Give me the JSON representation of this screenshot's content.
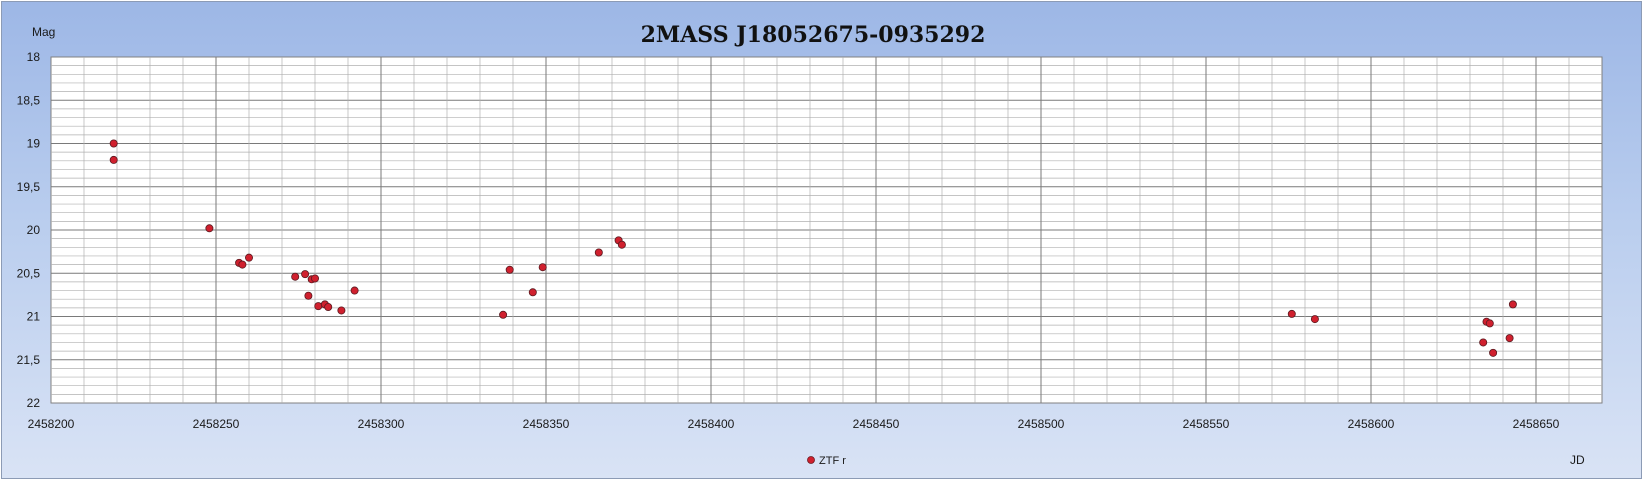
{
  "chart_data": {
    "type": "scatter",
    "title": "2MASS J18052675-0935292",
    "ylabel": "Mag",
    "xlabel": "JD",
    "x_ticks": [
      2458200,
      2458250,
      2458300,
      2458350,
      2458400,
      2458450,
      2458500,
      2458550,
      2458600,
      2458650
    ],
    "y_ticks": [
      "18",
      "18,5",
      "19",
      "19,5",
      "20",
      "20,5",
      "21",
      "21,5",
      "22"
    ],
    "xlim": [
      2458200,
      2458670
    ],
    "ylim": [
      18,
      22
    ],
    "y_inverted": true,
    "grid": true,
    "legend_position": "bottom-center",
    "series": [
      {
        "name": "ZTF r",
        "color": "#d0202e",
        "points": [
          [
            2458219,
            19.0
          ],
          [
            2458219,
            19.19
          ],
          [
            2458248,
            19.98
          ],
          [
            2458257,
            20.38
          ],
          [
            2458258,
            20.4
          ],
          [
            2458260,
            20.32
          ],
          [
            2458274,
            20.54
          ],
          [
            2458277,
            20.51
          ],
          [
            2458278,
            20.76
          ],
          [
            2458279,
            20.57
          ],
          [
            2458280,
            20.56
          ],
          [
            2458281,
            20.88
          ],
          [
            2458283,
            20.86
          ],
          [
            2458284,
            20.89
          ],
          [
            2458288,
            20.93
          ],
          [
            2458292,
            20.7
          ],
          [
            2458337,
            20.98
          ],
          [
            2458339,
            20.46
          ],
          [
            2458346,
            20.72
          ],
          [
            2458349,
            20.43
          ],
          [
            2458366,
            20.26
          ],
          [
            2458372,
            20.12
          ],
          [
            2458373,
            20.17
          ],
          [
            2458576,
            20.97
          ],
          [
            2458583,
            21.03
          ],
          [
            2458634,
            21.3
          ],
          [
            2458635,
            21.06
          ],
          [
            2458636,
            21.08
          ],
          [
            2458637,
            21.42
          ],
          [
            2458642,
            21.25
          ],
          [
            2458643,
            20.86
          ]
        ]
      }
    ]
  }
}
